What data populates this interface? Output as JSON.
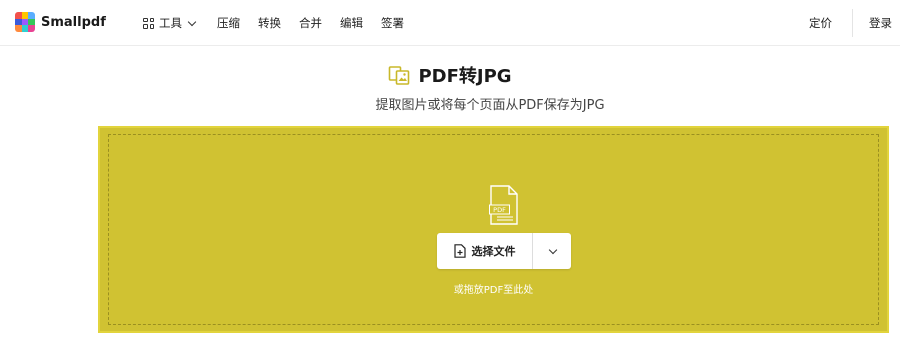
{
  "header": {
    "logo_text": "Smallpdf",
    "nav": {
      "tools_label": "工具",
      "items": [
        "压缩",
        "转换",
        "合并",
        "编辑",
        "签署"
      ]
    },
    "pricing_label": "定价",
    "login_label": "登录"
  },
  "hero": {
    "title": "PDF转JPG",
    "subtitle": "提取图片或将每个页面从PDF保存为JPG"
  },
  "dropzone": {
    "file_badge": "PDF",
    "choose_label": "选择文件",
    "drop_hint": "或拖放PDF至此处"
  },
  "colors": {
    "accent": "#d0c232",
    "logo_palette": [
      "#f2514b",
      "#ffc700",
      "#5aaeff",
      "#3b5bdb",
      "#9b59ff",
      "#35c759",
      "#ff8a3d",
      "#2ecfd1",
      "#e84393"
    ]
  }
}
